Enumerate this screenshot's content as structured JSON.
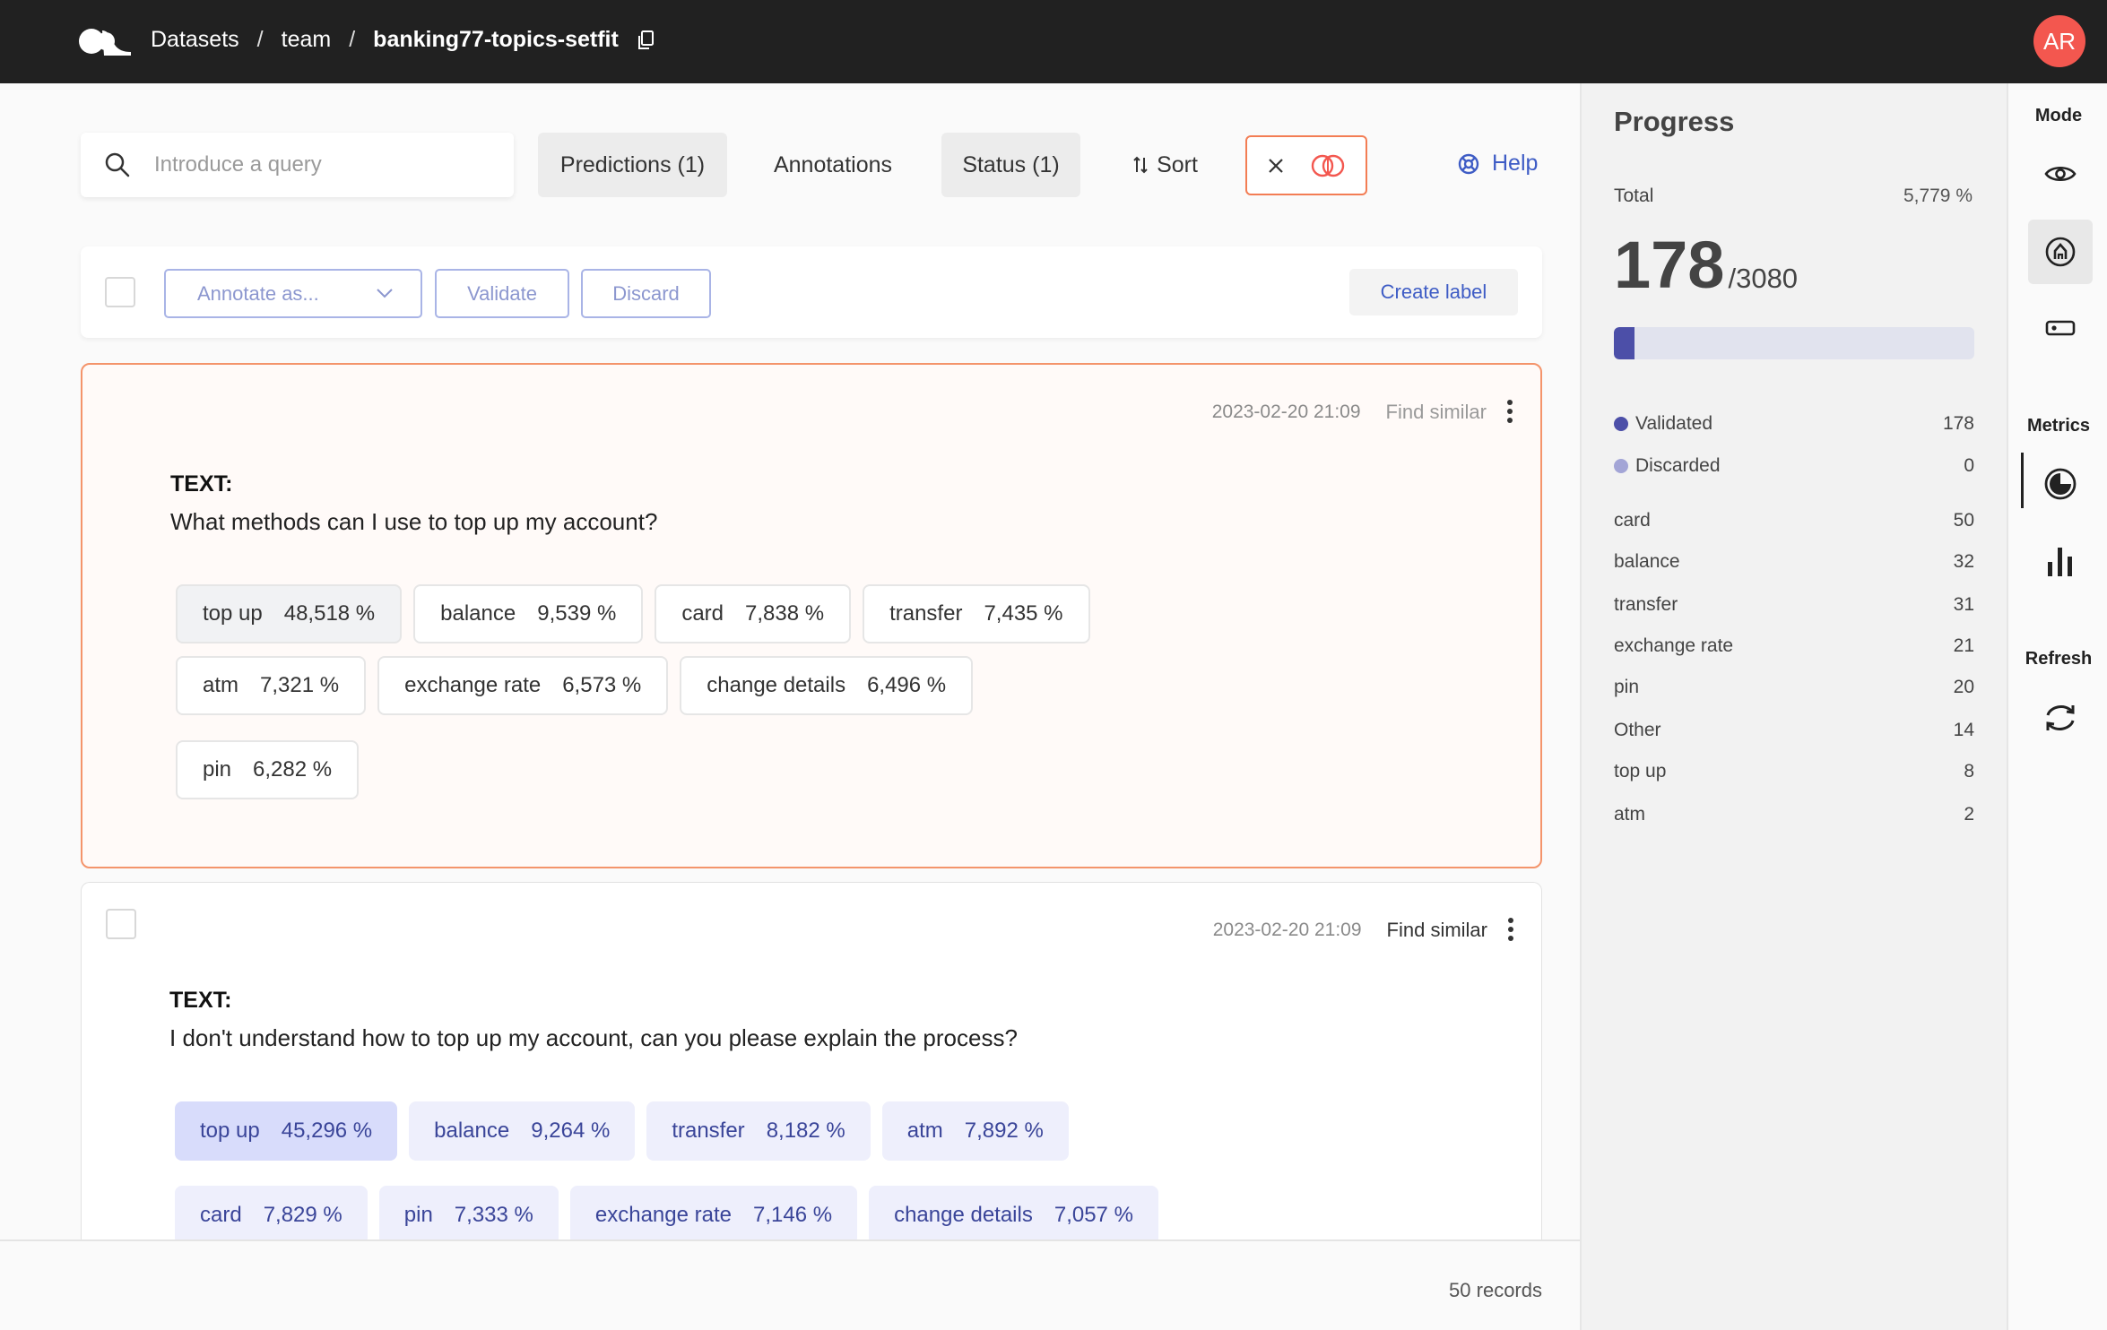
{
  "header": {
    "breadcrumbs": [
      "Datasets",
      "team",
      "banking77-topics-setfit"
    ],
    "separator": "/",
    "avatar_initials": "AR",
    "avatar_color": "#f3574f"
  },
  "toolbar": {
    "search_placeholder": "Introduce a query",
    "predictions_label": "Predictions (1)",
    "annotations_label": "Annotations",
    "status_label": "Status (1)",
    "sort_label": "Sort",
    "help_label": "Help"
  },
  "bulk": {
    "annotate_placeholder": "Annotate as...",
    "validate_label": "Validate",
    "discard_label": "Discard",
    "create_label": "Create label"
  },
  "records": [
    {
      "timestamp": "2023-02-20 21:09",
      "find_similar": "Find similar",
      "field_label": "TEXT:",
      "text": "What methods can I use to top up my account?",
      "predictions": [
        {
          "label": "top up",
          "score": "48,518 %"
        },
        {
          "label": "balance",
          "score": "9,539 %"
        },
        {
          "label": "card",
          "score": "7,838 %"
        },
        {
          "label": "transfer",
          "score": "7,435 %"
        },
        {
          "label": "atm",
          "score": "7,321 %"
        },
        {
          "label": "exchange rate",
          "score": "6,573 %"
        },
        {
          "label": "change details",
          "score": "6,496 %"
        },
        {
          "label": "pin",
          "score": "6,282 %"
        }
      ]
    },
    {
      "timestamp": "2023-02-20 21:09",
      "find_similar": "Find similar",
      "field_label": "TEXT:",
      "text": "I don't understand how to top up my account, can you please explain the process?",
      "predictions": [
        {
          "label": "top up",
          "score": "45,296 %"
        },
        {
          "label": "balance",
          "score": "9,264 %"
        },
        {
          "label": "transfer",
          "score": "8,182 %"
        },
        {
          "label": "atm",
          "score": "7,892 %"
        },
        {
          "label": "card",
          "score": "7,829 %"
        },
        {
          "label": "pin",
          "score": "7,333 %"
        },
        {
          "label": "exchange rate",
          "score": "7,146 %"
        },
        {
          "label": "change details",
          "score": "7,057 %"
        }
      ]
    }
  ],
  "footer": {
    "records_count": "50 records"
  },
  "progress": {
    "title": "Progress",
    "total_label": "Total",
    "total_pct": "5,779 %",
    "done": "178",
    "total": "/3080",
    "fill_fraction": 0.05779,
    "validated_label": "Validated",
    "validated_count": "178",
    "validated_color": "#4c4fa8",
    "discarded_label": "Discarded",
    "discarded_count": "0",
    "discarded_color": "#a3a5d6",
    "labels": [
      {
        "name": "card",
        "count": "50"
      },
      {
        "name": "balance",
        "count": "32"
      },
      {
        "name": "transfer",
        "count": "31"
      },
      {
        "name": "exchange rate",
        "count": "21"
      },
      {
        "name": "pin",
        "count": "20"
      },
      {
        "name": "Other",
        "count": "14"
      },
      {
        "name": "top up",
        "count": "8"
      },
      {
        "name": "atm",
        "count": "2"
      }
    ]
  },
  "rail": {
    "mode_title": "Mode",
    "metrics_title": "Metrics",
    "refresh_title": "Refresh",
    "icons": [
      "eye-icon",
      "annotate-icon",
      "label-icon",
      "progress-icon",
      "chart-icon",
      "refresh-icon"
    ]
  }
}
